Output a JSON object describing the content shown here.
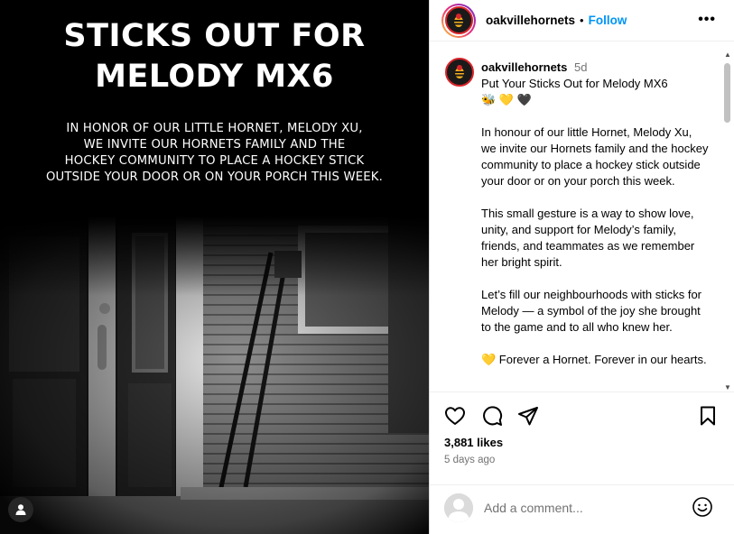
{
  "media": {
    "title_line1": "STICKS OUT FOR",
    "title_line2": "MELODY MX6",
    "body_lines": [
      "IN HONOR OF OUR LITTLE HORNET, MELODY XU,",
      "WE INVITE OUR HORNETS FAMILY AND THE",
      "HOCKEY COMMUNITY TO PLACE A HOCKEY STICK",
      "OUTSIDE YOUR DOOR OR ON YOUR PORCH THIS WEEK."
    ],
    "user_tag_icon": "person-icon"
  },
  "header": {
    "username": "oakvillehornets",
    "separator": "•",
    "follow_label": "Follow",
    "more_label": "•••"
  },
  "caption": {
    "username": "oakvillehornets",
    "time": "5d",
    "first_line": "Put Your Sticks Out for Melody MX6",
    "emojis": "🐝 💛 🖤",
    "paragraphs": [
      "In honour of our little Hornet, Melody Xu, we invite our Hornets family and the hockey community to place a hockey stick outside your door or on your porch this week.",
      "This small gesture is a way to show love, unity, and support for Melody’s family, friends, and teammates as we remember her bright spirit.",
      "Let’s fill our neighbourhoods with sticks for Melody — a symbol of the joy she brought to the game and to all who knew her.",
      "💛 Forever a Hornet. Forever in our hearts."
    ]
  },
  "actions": {
    "likes": "3,881 likes",
    "posted_ago": "5 days ago"
  },
  "comment": {
    "placeholder": "Add a comment..."
  },
  "colors": {
    "accent": "#0095f6",
    "muted": "#737373",
    "brand_red": "#d8242a"
  }
}
